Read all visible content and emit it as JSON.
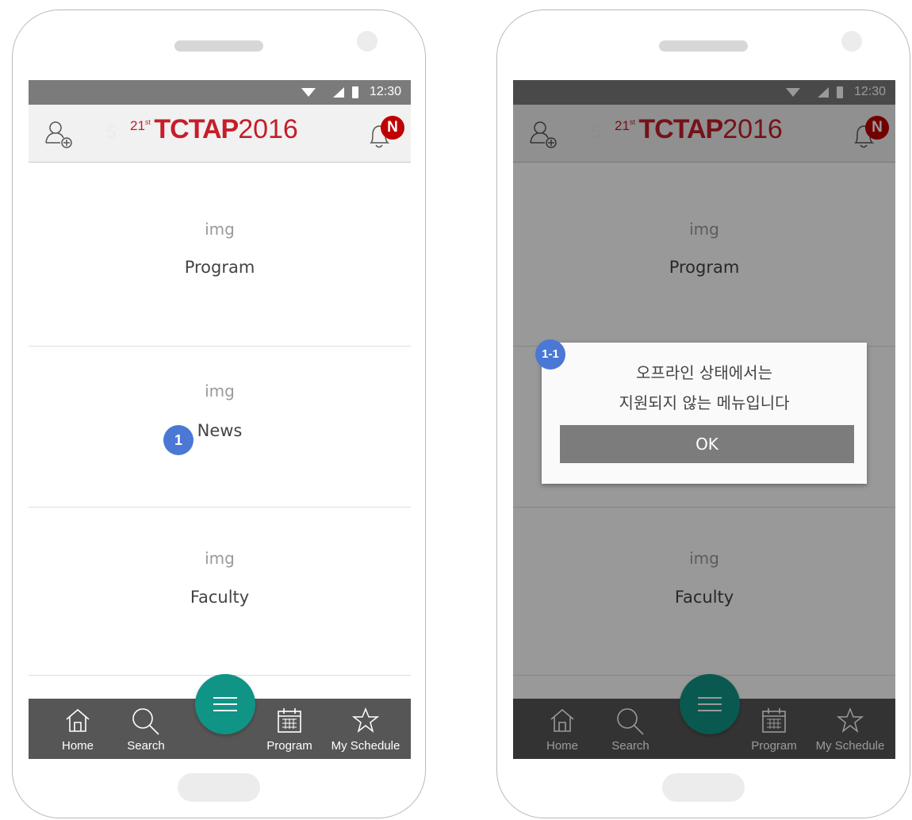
{
  "statusbar": {
    "time": "12:30"
  },
  "appbar": {
    "logo_ordinal": "21st",
    "logo_bold": "TCTAP",
    "logo_year": "2016",
    "faint_digit": "5",
    "notification_badge": "N"
  },
  "menu_items": [
    {
      "img": "img",
      "label": "Program"
    },
    {
      "img": "img",
      "label": "News"
    },
    {
      "img": "img",
      "label": "Faculty"
    }
  ],
  "bottom_nav": [
    {
      "label": "Home",
      "icon": "home-icon"
    },
    {
      "label": "Search",
      "icon": "search-icon"
    },
    {
      "label": "Program",
      "icon": "calendar-icon"
    },
    {
      "label": "My Schedule",
      "icon": "star-icon"
    }
  ],
  "annotations": {
    "marker_1": "1",
    "marker_1_1": "1-1"
  },
  "dialog": {
    "line1": "오프라인 상태에서는",
    "line2": "지원되지 않는 메뉴입니다",
    "ok_label": "OK"
  },
  "colors": {
    "brand_red": "#c41e2a",
    "fab_teal": "#0f9486",
    "badge_red": "#c00000",
    "marker_blue": "#4a78d4",
    "nav_bg": "#565656",
    "status_bg": "#7b7b7b"
  }
}
